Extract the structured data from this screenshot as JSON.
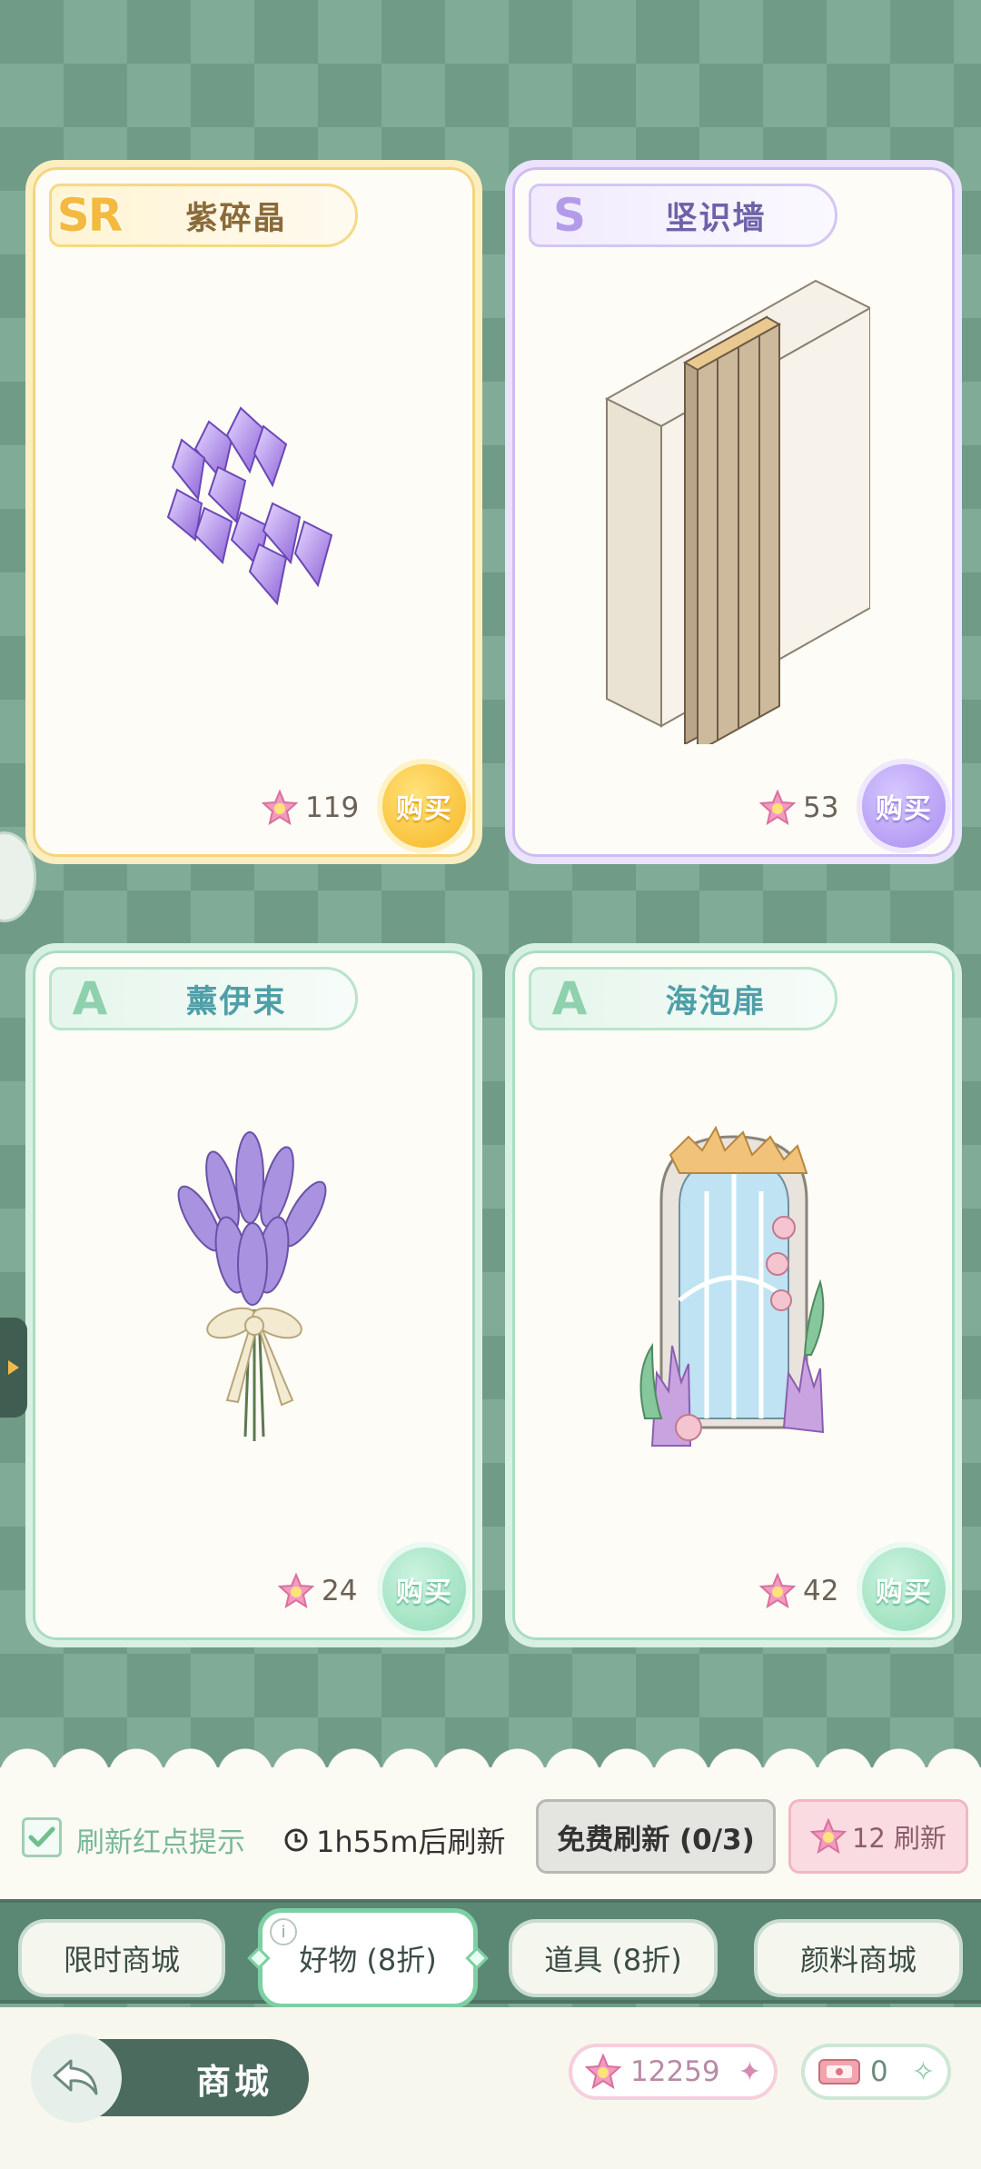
{
  "cards": [
    {
      "rarity": "SR",
      "name": "紫碎晶",
      "price": "119",
      "buy_label": "购买"
    },
    {
      "rarity": "S",
      "name": "坚识墙",
      "price": "53",
      "buy_label": "购买"
    },
    {
      "rarity": "A",
      "name": "薰伊束",
      "price": "24",
      "buy_label": "购买"
    },
    {
      "rarity": "A",
      "name": "海泡扉",
      "price": "42",
      "buy_label": "购买"
    }
  ],
  "refresh_bar": {
    "checkbox_label": "刷新红点提示",
    "checkbox_checked": true,
    "timer_text": "1h55m后刷新",
    "free_refresh_label": "免费刷新 (0/3)",
    "paid_refresh_label": "12 刷新"
  },
  "tabs": [
    {
      "label": "限时商城",
      "active": false
    },
    {
      "label": "好物 (8折)",
      "active": true
    },
    {
      "label": "道具 (8折)",
      "active": false
    },
    {
      "label": "颜料商城",
      "active": false
    }
  ],
  "tab_info_icon": "i",
  "bottom_bar": {
    "title": "商城",
    "gem_balance": "12259",
    "ticket_balance": "0"
  },
  "colors": {
    "background": "#6f9b87",
    "sr_accent": "#f3b940",
    "s_accent": "#b49be9",
    "a_accent": "#8fd0ad",
    "star_currency": "#f08bb6"
  },
  "icons": {
    "price": "star-gem-icon",
    "back": "back-arrow-icon",
    "clock": "clock-icon",
    "checkbox": "checkmark-icon",
    "ticket": "ticket-icon",
    "plus": "plus-sparkle-icon"
  }
}
